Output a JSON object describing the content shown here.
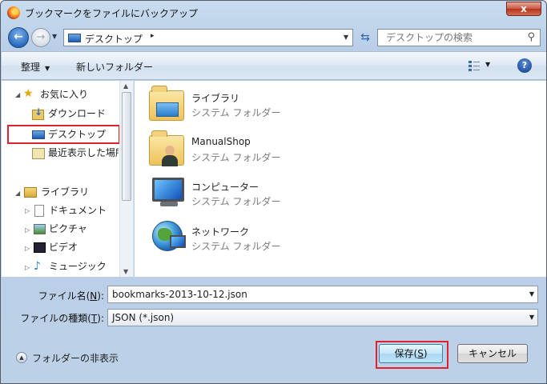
{
  "window": {
    "title": "ブックマークをファイルにバックアップ",
    "close_label": "x"
  },
  "nav": {
    "back_glyph": "←",
    "forward_glyph": "→",
    "address_text": "デスクトップ",
    "address_arrow": "▸",
    "search_placeholder": "デスクトップの検索"
  },
  "toolbar": {
    "organize_label": "整理",
    "new_folder_label": "新しいフォルダー",
    "help_label": "?"
  },
  "sidebar": {
    "favorites": {
      "label": "お気に入り",
      "items": [
        {
          "label": "ダウンロード",
          "icon": "download-folder-icon"
        },
        {
          "label": "デスクトップ",
          "icon": "desktop-icon"
        },
        {
          "label": "最近表示した場所",
          "icon": "recent-places-icon"
        }
      ]
    },
    "libraries": {
      "label": "ライブラリ",
      "items": [
        {
          "label": "ドキュメント",
          "icon": "documents-icon"
        },
        {
          "label": "ピクチャ",
          "icon": "pictures-icon"
        },
        {
          "label": "ビデオ",
          "icon": "videos-icon"
        },
        {
          "label": "ミュージック",
          "icon": "music-icon"
        }
      ]
    }
  },
  "content": {
    "items": [
      {
        "name": "ライブラリ",
        "type": "システム フォルダー",
        "icon": "libraries-icon"
      },
      {
        "name": "ManualShop",
        "type": "システム フォルダー",
        "icon": "user-folder-icon"
      },
      {
        "name": "コンピューター",
        "type": "システム フォルダー",
        "icon": "computer-icon"
      },
      {
        "name": "ネットワーク",
        "type": "システム フォルダー",
        "icon": "network-icon"
      }
    ]
  },
  "form": {
    "filename_label_pre": "ファイル名(",
    "filename_key": "N",
    "filename_label_post": "):",
    "filename_value": "bookmarks-2013-10-12.json",
    "filetype_label_pre": "ファイルの種類(",
    "filetype_key": "T",
    "filetype_label_post": "):",
    "filetype_value": "JSON (*.json)",
    "hide_folders_label": "フォルダーの非表示",
    "save_pre": "保存(",
    "save_key": "S",
    "save_post": ")",
    "cancel_label": "キャンセル"
  },
  "colors": {
    "highlight_outline": "#e0222e",
    "accent": "#2c6cc1"
  }
}
